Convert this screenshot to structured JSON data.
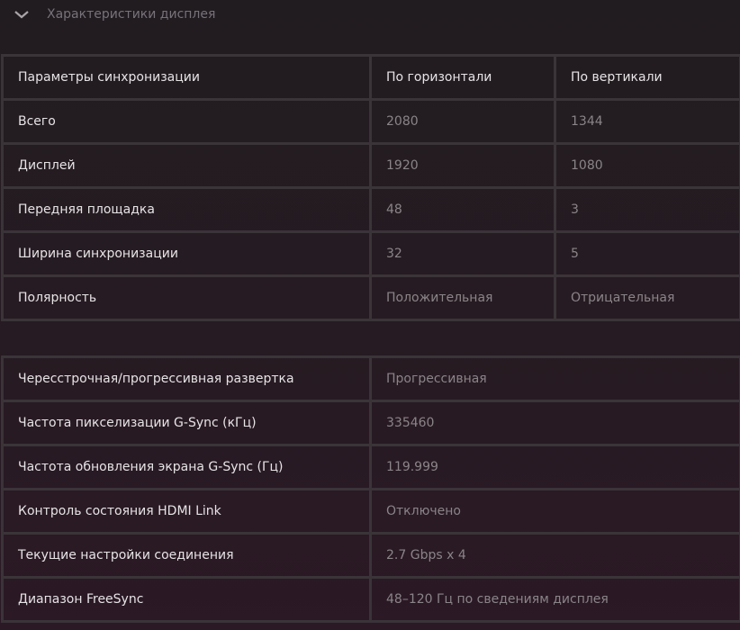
{
  "section": {
    "title": "Характеристики дисплея",
    "icon": "chevron-down-icon"
  },
  "timing_table": {
    "headers": [
      "Параметры синхронизации",
      "По горизонтали",
      "По вертикали"
    ],
    "rows": [
      {
        "label": "Всего",
        "h": "2080",
        "v": "1344"
      },
      {
        "label": "Дисплей",
        "h": "1920",
        "v": "1080"
      },
      {
        "label": "Передняя площадка",
        "h": "48",
        "v": "3"
      },
      {
        "label": "Ширина синхронизации",
        "h": "32",
        "v": "5"
      },
      {
        "label": "Полярность",
        "h": "Положительная",
        "v": "Отрицательная"
      }
    ]
  },
  "info_table": {
    "rows": [
      {
        "label": "Чересстрочная/прогрессивная развертка",
        "value": "Прогрессивная"
      },
      {
        "label": "Частота пикселизации G-Sync (кГц)",
        "value": "335460"
      },
      {
        "label": "Частота обновления экрана G-Sync (Гц)",
        "value": "119.999"
      },
      {
        "label": "Контроль состояния HDMI Link",
        "value": "Отключено"
      },
      {
        "label": "Текущие настройки соединения",
        "value": "2.7 Gbps x 4"
      },
      {
        "label": "Диапазон FreeSync",
        "value": "48–120 Гц по сведениям дисплея"
      }
    ]
  }
}
